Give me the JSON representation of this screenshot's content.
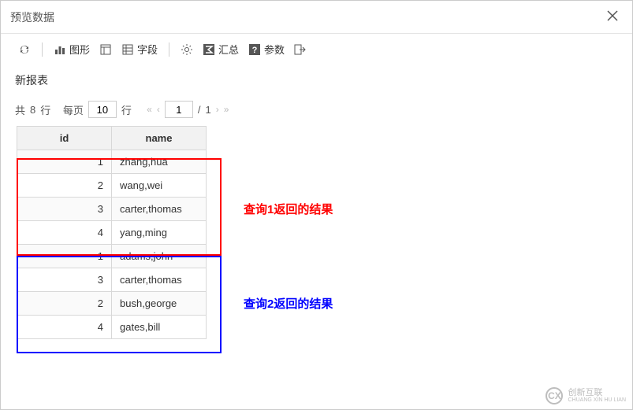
{
  "titlebar": {
    "title": "预览数据"
  },
  "toolbar": {
    "chart_label": "图形",
    "fields_label": "字段",
    "summary_label": "汇总",
    "params_label": "参数"
  },
  "report": {
    "title": "新报表"
  },
  "pager": {
    "total_prefix": "共",
    "total_count": "8",
    "total_suffix": "行",
    "per_page_label": "每页",
    "page_size": "10",
    "rows_suffix": "行",
    "current_page": "1",
    "total_pages": "1"
  },
  "table": {
    "headers": {
      "id": "id",
      "name": "name"
    },
    "group1": [
      {
        "id": "1",
        "name": "zhang,hua"
      },
      {
        "id": "2",
        "name": "wang,wei"
      },
      {
        "id": "3",
        "name": "carter,thomas"
      },
      {
        "id": "4",
        "name": "yang,ming"
      }
    ],
    "group2": [
      {
        "id": "1",
        "name": "adams,john"
      },
      {
        "id": "3",
        "name": "carter,thomas"
      },
      {
        "id": "2",
        "name": "bush,george"
      },
      {
        "id": "4",
        "name": "gates,bill"
      }
    ]
  },
  "annotations": {
    "query1": "查询1返回的结果",
    "query2": "查询2返回的结果",
    "box1_color": "#ff0000",
    "box2_color": "#0000ff"
  },
  "watermark": {
    "brand_cn": "创新互联",
    "brand_en": "CHUANG XIN HU LIAN"
  }
}
